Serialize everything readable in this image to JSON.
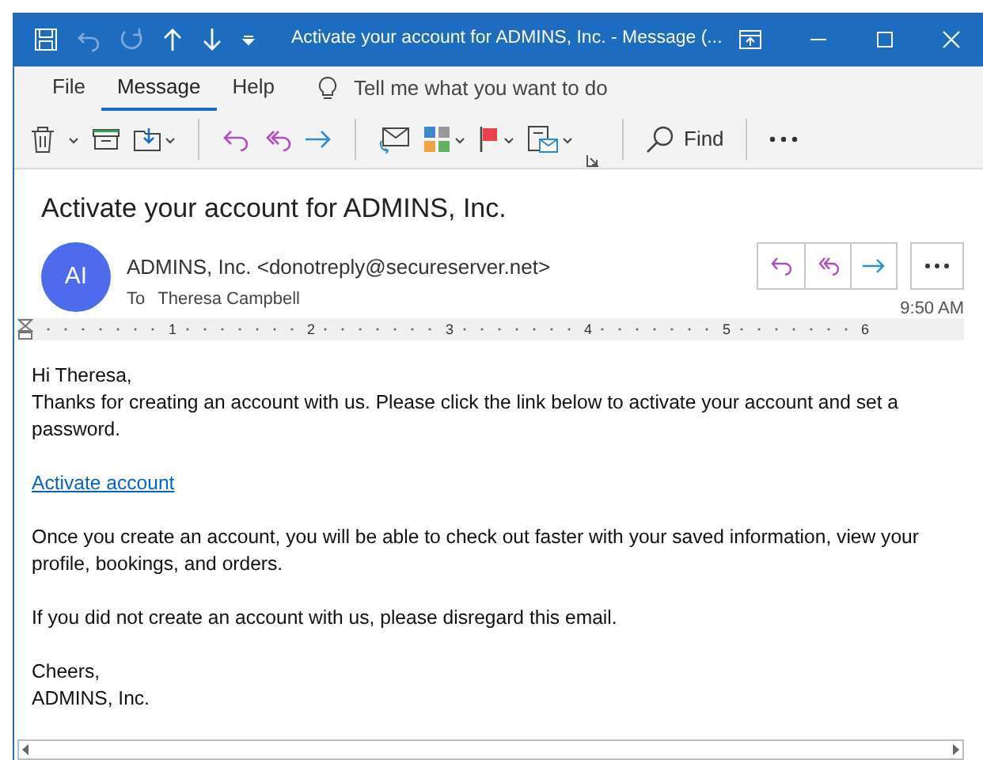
{
  "window": {
    "title": "Activate your account for ADMINS, Inc.  -  Message (..."
  },
  "ribbon_tabs": [
    {
      "label": "File",
      "selected": false
    },
    {
      "label": "Message",
      "selected": true
    },
    {
      "label": "Help",
      "selected": false
    }
  ],
  "tell_me": {
    "placeholder": "Tell me what you want to do"
  },
  "toolbar": {
    "find_label": "Find"
  },
  "message": {
    "subject": "Activate your account for ADMINS, Inc.",
    "avatar": "AI",
    "sender": "ADMINS, Inc. <donotreply@secureserver.net>",
    "to_label": "To",
    "recipient": "Theresa Campbell",
    "time": "9:50 AM"
  },
  "ruler": [
    "1",
    "2",
    "3",
    "4",
    "5",
    "6"
  ],
  "body": [
    {
      "kind": "lines",
      "lines": [
        "Hi Theresa,",
        "Thanks for creating an account with us. Please click the link below to activate your account and set a password."
      ]
    },
    {
      "kind": "link",
      "text": "Activate account"
    },
    {
      "kind": "lines",
      "lines": [
        "Once you create an account, you will be able to check out faster with your saved information, view your profile, bookings, and orders."
      ]
    },
    {
      "kind": "lines",
      "lines": [
        "If you did not create an account with us, please disregard this email."
      ]
    },
    {
      "kind": "lines",
      "lines": [
        "Cheers,",
        "ADMINS, Inc."
      ]
    }
  ]
}
